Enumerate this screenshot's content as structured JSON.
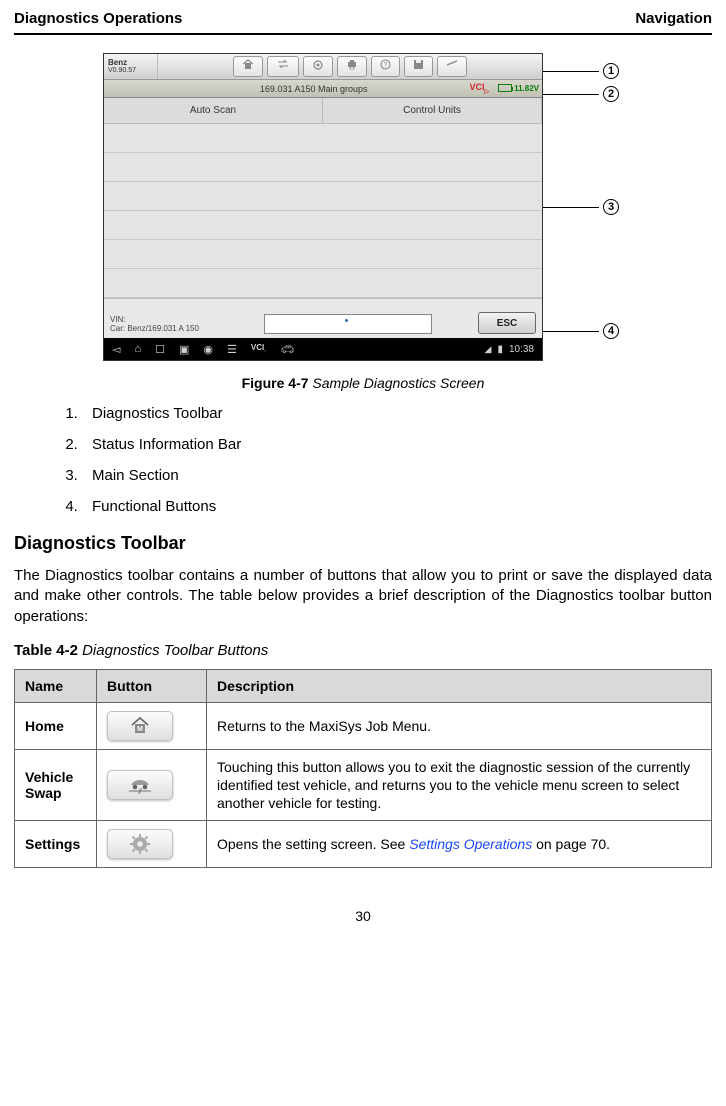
{
  "header": {
    "left": "Diagnostics Operations",
    "right": "Navigation"
  },
  "figure": {
    "logo_primary": "Benz",
    "logo_secondary": "V0.90.57",
    "status_mid": "169.031 A150 Main groups",
    "status_vci": "VCI",
    "status_batt": "11.82V",
    "tab1": "Auto Scan",
    "tab2": "Control Units",
    "vin_line1": "VIN:",
    "vin_line2": "Car: Benz/169.031 A 150",
    "esc": "ESC",
    "android_time": "10:38",
    "callouts": [
      "1",
      "2",
      "3",
      "4"
    ]
  },
  "figcap": {
    "bold": "Figure 4-7 ",
    "ital": "Sample Diagnostics Screen"
  },
  "list": [
    "Diagnostics Toolbar",
    "Status Information Bar",
    "Main Section",
    "Functional Buttons"
  ],
  "section_heading": "Diagnostics Toolbar",
  "section_body": "The Diagnostics toolbar contains a number of buttons that allow you to print or save the displayed data and make other controls. The table below provides a brief description of the Diagnostics toolbar button operations:",
  "tablecap": {
    "bold": "Table 4-2 ",
    "ital": "Diagnostics Toolbar Buttons"
  },
  "table": {
    "headers": [
      "Name",
      "Button",
      "Description"
    ],
    "rows": [
      {
        "name": "Home",
        "desc": "Returns to the MaxiSys Job Menu."
      },
      {
        "name": "Vehicle Swap",
        "desc": "Touching this button allows you to exit the diagnostic session of the currently identified test vehicle, and returns you to the vehicle menu screen to select another vehicle for testing."
      },
      {
        "name": "Settings",
        "desc_pre": "Opens the setting screen. See ",
        "desc_link": "Settings Operations",
        "desc_post": " on page 70."
      }
    ]
  },
  "page_number": "30"
}
